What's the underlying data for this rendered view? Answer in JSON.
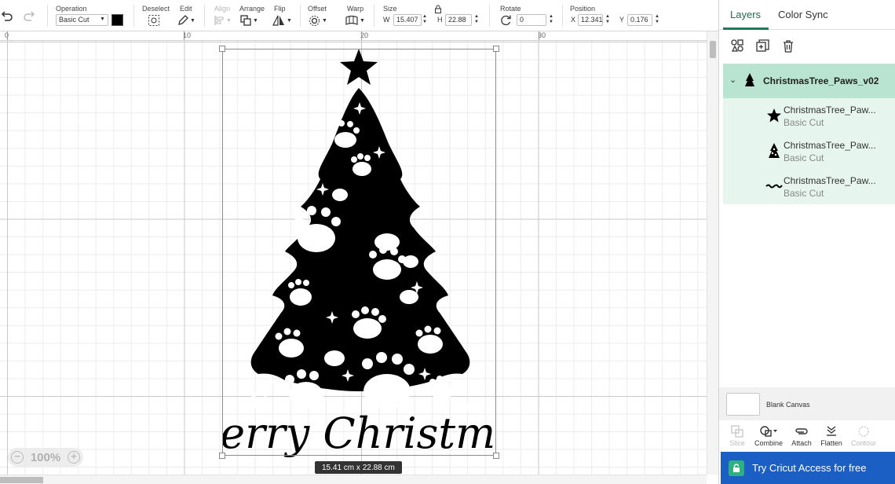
{
  "toolbar": {
    "undo_icon": "undo-icon",
    "redo_icon": "redo-icon",
    "operation": {
      "label": "Operation",
      "value": "Basic Cut",
      "color": "#000000"
    },
    "deselect": {
      "label": "Deselect"
    },
    "edit": {
      "label": "Edit"
    },
    "align": {
      "label": "Align",
      "disabled": true
    },
    "arrange": {
      "label": "Arrange"
    },
    "flip": {
      "label": "Flip"
    },
    "offset": {
      "label": "Offset"
    },
    "warp": {
      "label": "Warp"
    },
    "size": {
      "label": "Size",
      "w_label": "W",
      "w_value": "15.407",
      "h_label": "H",
      "h_value": "22.88"
    },
    "rotate": {
      "label": "Rotate",
      "value": "0"
    },
    "position": {
      "label": "Position",
      "x_label": "X",
      "x_value": "12.341",
      "y_label": "Y",
      "y_value": "0.176"
    }
  },
  "ruler": {
    "marks": [
      "0",
      "10",
      "20",
      "30"
    ]
  },
  "canvas": {
    "headline": "Merry Christmas",
    "size_badge": "15.41  cm x 22.88  cm",
    "zoom": "100%",
    "zoom_out": "−",
    "zoom_in": "+"
  },
  "panel": {
    "tabs": [
      {
        "label": "Layers",
        "active": true
      },
      {
        "label": "Color Sync",
        "active": false
      }
    ],
    "group": {
      "name": "ChristmasTree_Paws_v02",
      "expanded": true
    },
    "layers": [
      {
        "name": "ChristmasTree_Paw...",
        "operation": "Basic Cut",
        "icon": "star-icon"
      },
      {
        "name": "ChristmasTree_Paw...",
        "operation": "Basic Cut",
        "icon": "tree-icon"
      },
      {
        "name": "ChristmasTree_Paw...",
        "operation": "Basic Cut",
        "icon": "script-text-icon"
      }
    ],
    "blank_canvas": "Blank Canvas",
    "bottom_tools": [
      {
        "label": "Slice",
        "disabled": true
      },
      {
        "label": "Combine",
        "disabled": false
      },
      {
        "label": "Attach",
        "disabled": false
      },
      {
        "label": "Flatten",
        "disabled": false
      },
      {
        "label": "Contour",
        "disabled": true
      }
    ],
    "try_banner": "Try Cricut Access for free",
    "accent": "#1c5fc4",
    "selected_layer_bg": "#b9e4d1"
  }
}
